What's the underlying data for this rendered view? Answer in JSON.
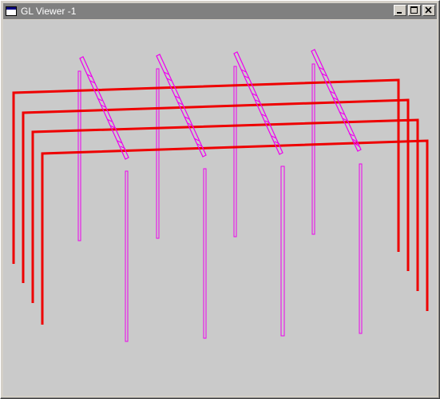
{
  "window": {
    "title": "GL Viewer -1",
    "icons": {
      "app": "app-window-icon",
      "minimize": "minimize-icon",
      "maximize": "maximize-icon",
      "close": "close-icon"
    }
  },
  "colors": {
    "titlebar_inactive": "#808080",
    "viewport_bg": "#cacaca",
    "frame_red": "#ee0000",
    "panel_magenta": "#ee00ee"
  },
  "scene": {
    "description_type": "wireframe 3D view",
    "red_frames_count": 4,
    "magenta_rows_count": 4
  }
}
